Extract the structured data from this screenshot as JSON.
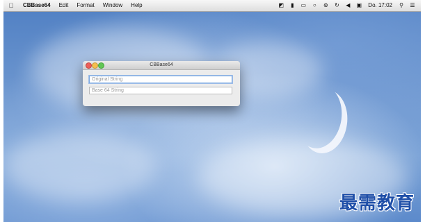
{
  "menubar": {
    "apple_icon": "apple-logo-icon",
    "app_name": "CBBase64",
    "items": [
      "Edit",
      "Format",
      "Window",
      "Help"
    ],
    "status_icons": [
      "headphones-icon",
      "battery-bar-icon",
      "airplay-icon",
      "messages-icon",
      "bluetooth-icon",
      "time-machine-icon",
      "volume-icon",
      "input-source-icon"
    ],
    "clock": "Do. 17:02",
    "search_icon": "spotlight-search-icon",
    "notification_icon": "notification-center-icon"
  },
  "window": {
    "title": "CBBase64",
    "original_field": {
      "placeholder": "Original String",
      "value": ""
    },
    "base64_field": {
      "placeholder": "Base 64 String",
      "value": ""
    }
  },
  "watermark": "最需教育"
}
